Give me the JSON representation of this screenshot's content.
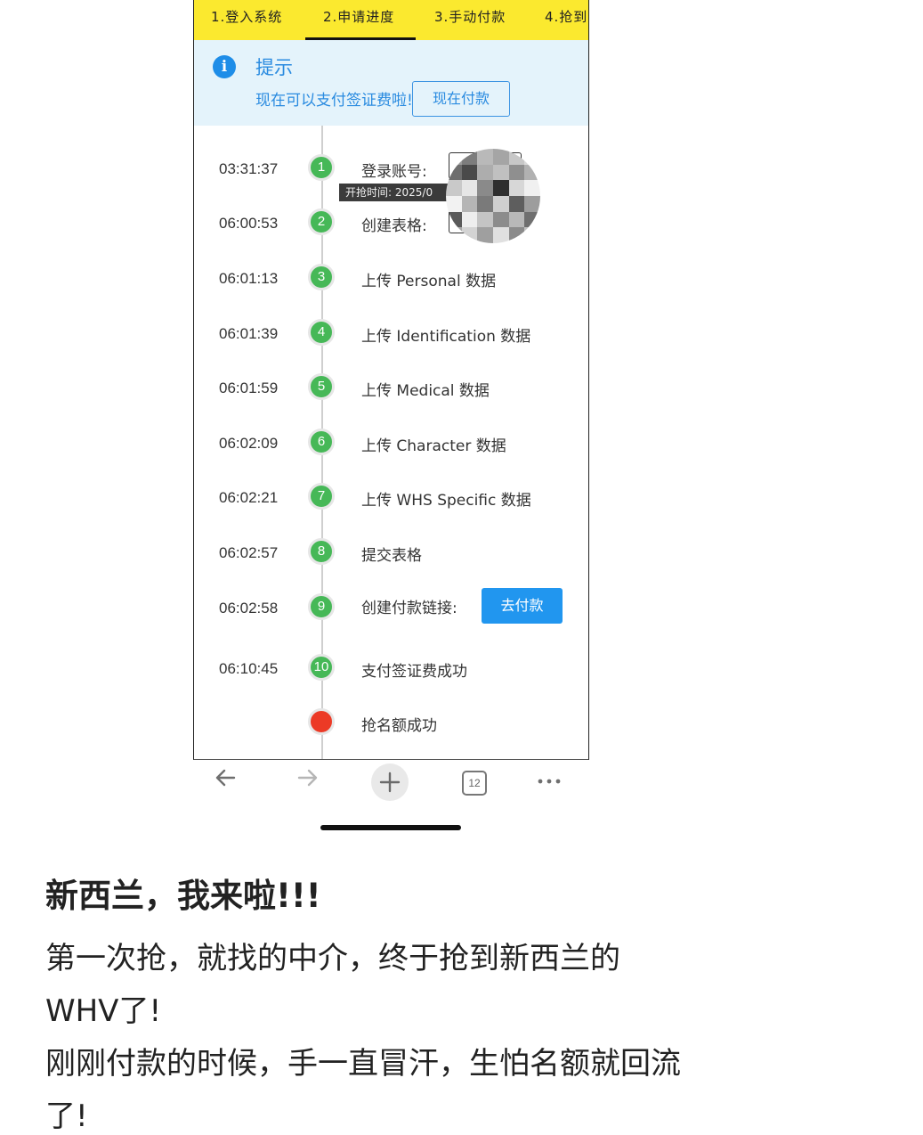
{
  "tabs": [
    "1.登入系统",
    "2.申请进度",
    "3.手动付款",
    "4.抢到"
  ],
  "notice": {
    "title": "提示",
    "text": "现在可以支付签证费啦!",
    "button": "现在付款"
  },
  "timeline": [
    {
      "time": "03:31:37",
      "num": "1",
      "label": "登录账号:"
    },
    {
      "time": "06:00:53",
      "num": "2",
      "label": "创建表格:"
    },
    {
      "time": "06:01:13",
      "num": "3",
      "label": "上传 Personal 数据"
    },
    {
      "time": "06:01:39",
      "num": "4",
      "label": "上传 Identification 数据"
    },
    {
      "time": "06:01:59",
      "num": "5",
      "label": "上传 Medical 数据"
    },
    {
      "time": "06:02:09",
      "num": "6",
      "label": "上传 Character 数据"
    },
    {
      "time": "06:02:21",
      "num": "7",
      "label": "上传 WHS Specific 数据"
    },
    {
      "time": "06:02:57",
      "num": "8",
      "label": "提交表格"
    },
    {
      "time": "06:02:58",
      "num": "9",
      "label": "创建付款链接:"
    },
    {
      "time": "06:10:45",
      "num": "10",
      "label": "支付签证费成功"
    },
    {
      "time": "",
      "num": "",
      "label": "抢名额成功"
    }
  ],
  "tooltip": "开抢时间: 2025/0",
  "go_pay_button": "去付款",
  "browser": {
    "back_icon": "arrow-left-icon",
    "forward_icon": "arrow-right-icon",
    "new_tab_icon": "plus-icon",
    "tab_count": "12",
    "more_icon": "more-dots-icon"
  },
  "post": {
    "title": "新西兰，我来啦!!!",
    "lines": [
      "第一次抢，就找的中介，终于抢到新西兰的",
      " WHV了!",
      "刚刚付款的时候，手一直冒汗，生怕名额就回流",
      "了!"
    ]
  },
  "colors": {
    "tab_bar": "#fbe92f",
    "notice_bg": "#e4f3fb",
    "accent_blue": "#2196ef",
    "step_green": "#46b857",
    "final_red": "#ec3a26"
  }
}
